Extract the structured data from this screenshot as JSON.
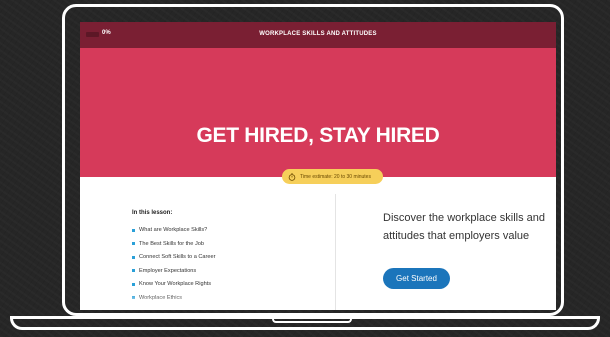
{
  "header": {
    "progress_label": "0%",
    "progress_value": 0,
    "course_title": "WORKPLACE SKILLS AND ATTITUDES"
  },
  "hero": {
    "title": "GET HIRED, STAY HIRED",
    "time_estimate": "Time estimate: 20 to 30 minutes",
    "time_icon": "stopwatch-icon"
  },
  "lesson": {
    "heading": "In this lesson:",
    "items": [
      "What are Workplace Skills?",
      "The Best Skills for the Job",
      "Connect Soft Skills to a Career",
      "Employer Expectations",
      "Know Your Workplace Rights",
      "Workplace Ethics"
    ]
  },
  "cta": {
    "description": "Discover the workplace skills and attitudes that employers value",
    "button_label": "Get Started"
  },
  "colors": {
    "header_bg": "#7a1f33",
    "hero_bg": "#d63a5a",
    "badge_bg": "#f6cf5a",
    "button_bg": "#1b75bb",
    "bullet": "#2aa0d8"
  }
}
